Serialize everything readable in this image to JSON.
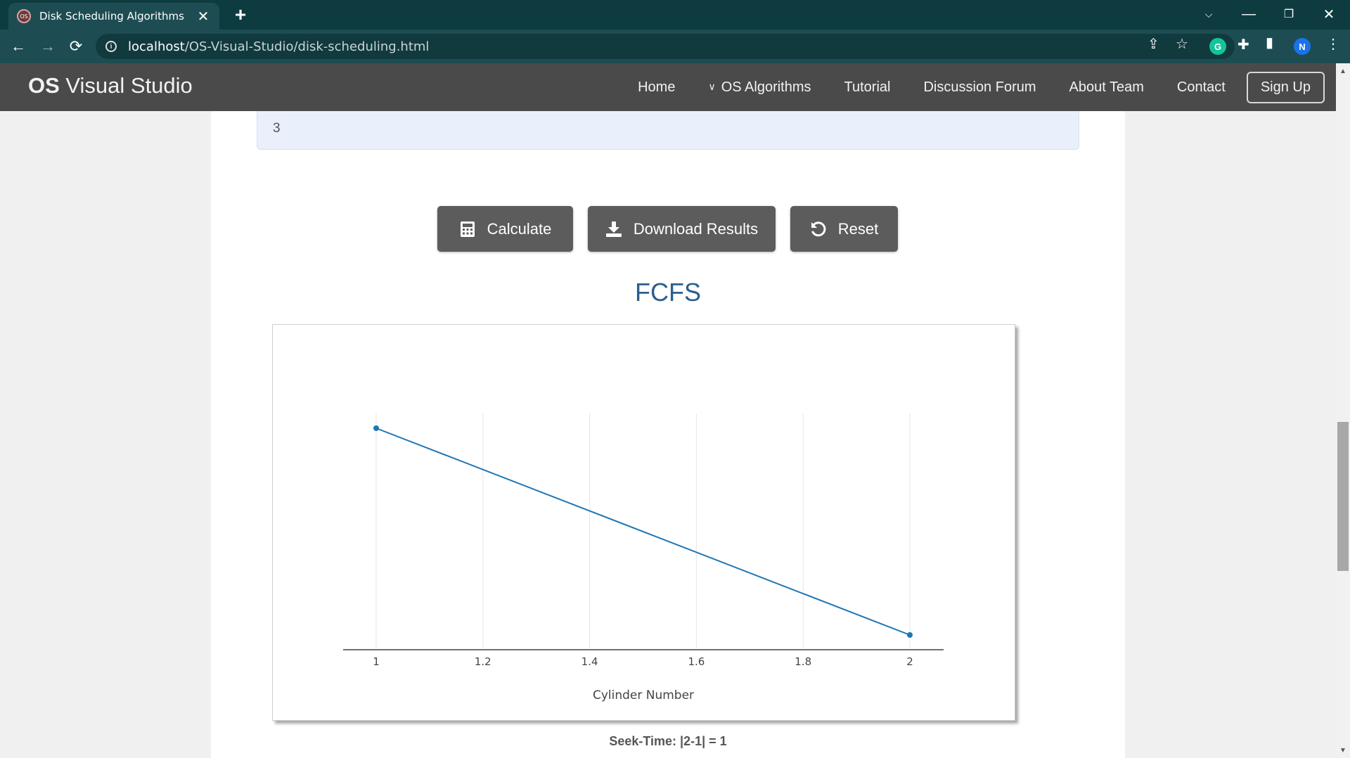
{
  "browser": {
    "tab_title": "Disk Scheduling Algorithms",
    "tab_favicon": "OS",
    "url_host": "localhost",
    "url_path": "/OS-Visual-Studio/disk-scheduling.html",
    "profile_initial": "N",
    "grammarly_initial": "G"
  },
  "site": {
    "brand_bold": "OS",
    "brand_rest": " Visual Studio",
    "nav": {
      "home": "Home",
      "os_algorithms": "OS Algorithms",
      "tutorial": "Tutorial",
      "forum": "Discussion Forum",
      "about": "About Team",
      "contact": "Contact",
      "signup": "Sign Up"
    }
  },
  "form": {
    "input_value": "3"
  },
  "buttons": {
    "calculate": "Calculate",
    "download": "Download Results",
    "reset": "Reset"
  },
  "result": {
    "title": "FCFS",
    "seek_time": "Seek-Time: |2-1| = 1"
  },
  "chart_data": {
    "type": "line",
    "title": "FCFS",
    "xlabel": "Cylinder Number",
    "ylabel": "",
    "x_ticks": [
      "1",
      "1.2",
      "1.4",
      "1.6",
      "1.8",
      "2"
    ],
    "xlim": [
      0.875,
      2.0
    ],
    "series": [
      {
        "points": [
          {
            "x": 1,
            "y": 1
          },
          {
            "x": 2,
            "y": 2
          }
        ]
      }
    ],
    "y_reversed": true,
    "grid": "vertical",
    "line_color": "#1f77b4"
  },
  "colors": {
    "navbar": "#4a4a4a",
    "button": "#5c5c5c",
    "title": "#2c5e8f",
    "browser_tabbar": "#0d3b40"
  }
}
